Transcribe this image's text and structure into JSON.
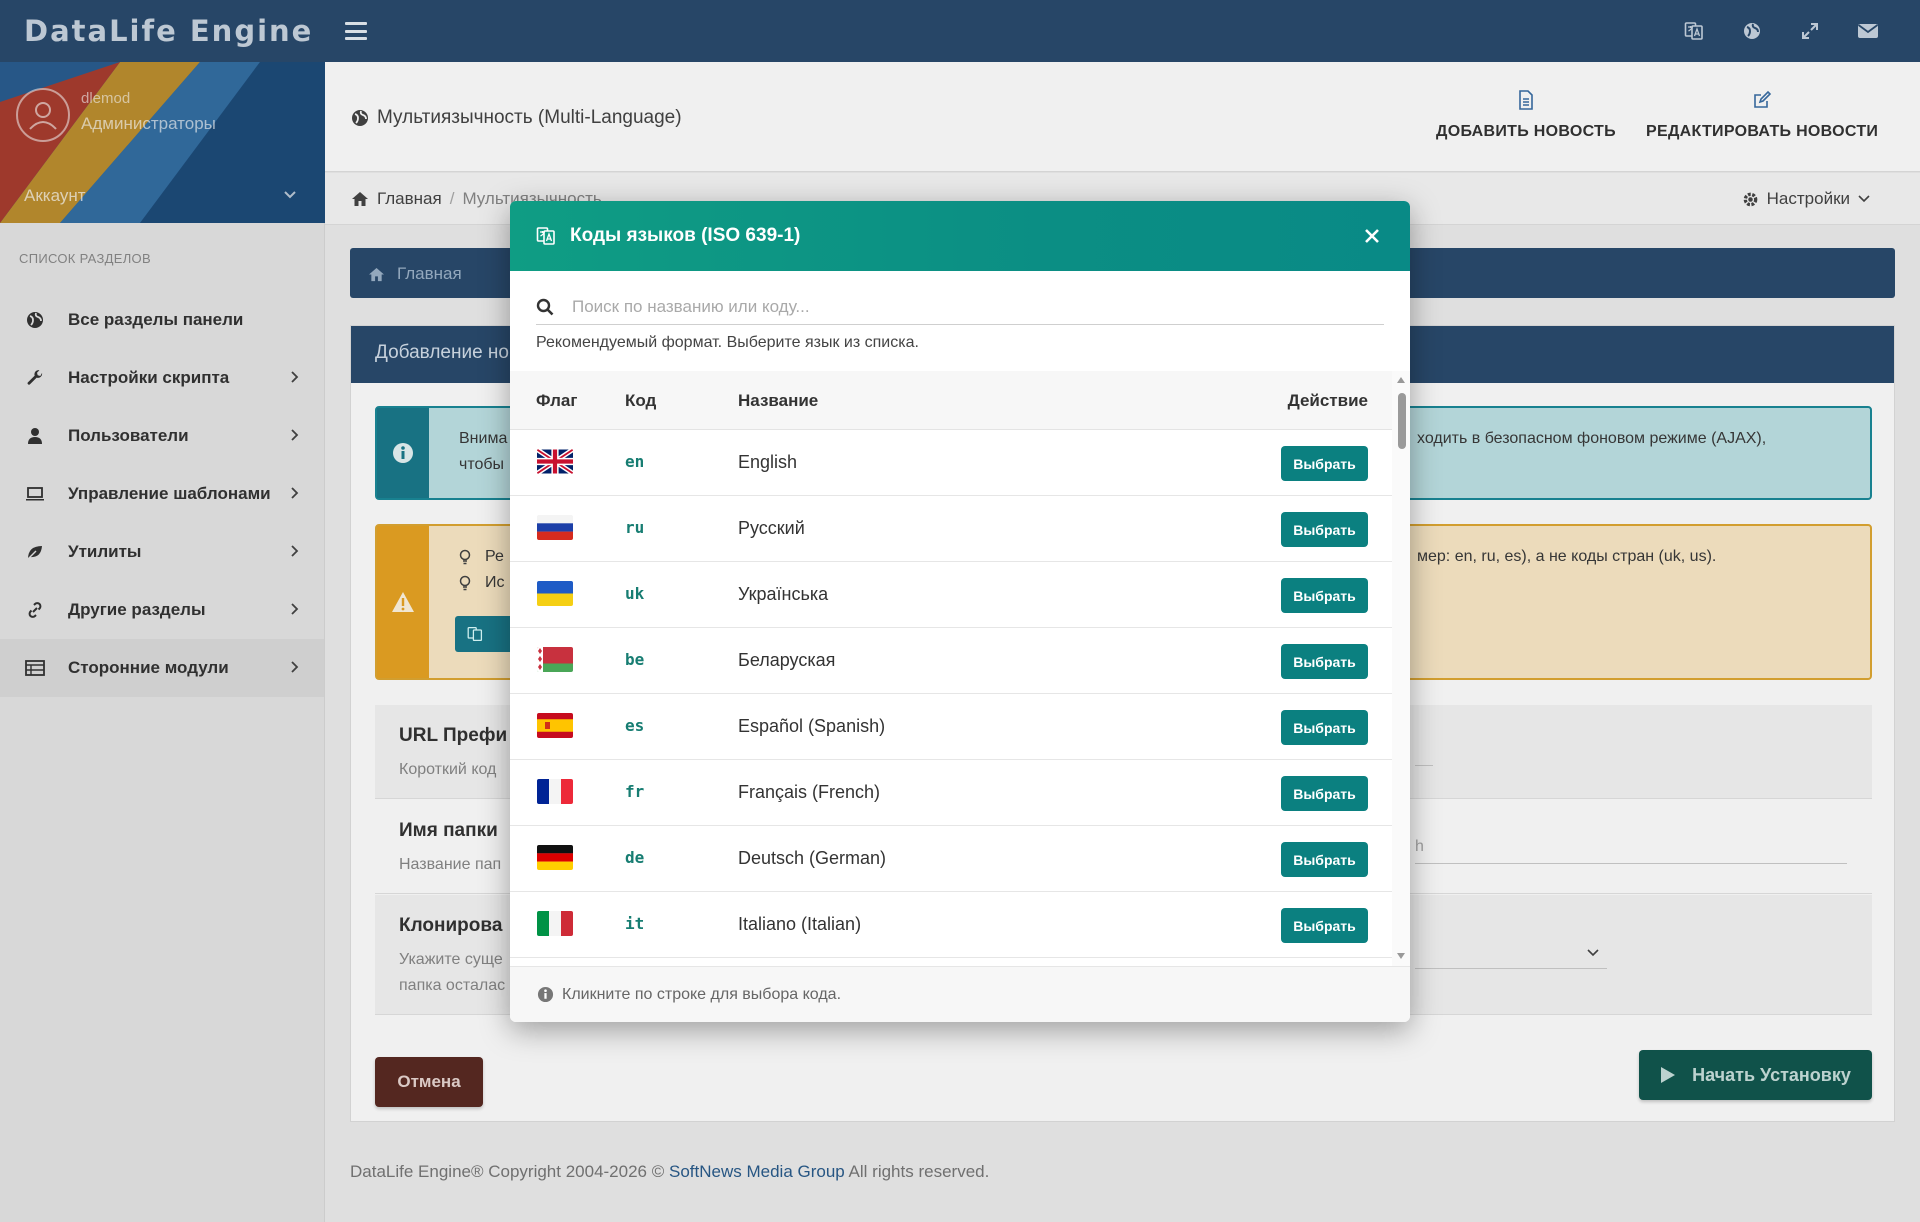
{
  "app": {
    "brand": "DataLife Engine"
  },
  "user": {
    "name": "dlemod",
    "role": "Администраторы",
    "account_label": "Аккаунт"
  },
  "sidebar": {
    "title": "СПИСОК РАЗДЕЛОВ",
    "items": [
      {
        "label": "Все разделы панели",
        "icon": "globe-icon"
      },
      {
        "label": "Настройки скрипта",
        "icon": "wrench-icon"
      },
      {
        "label": "Пользователи",
        "icon": "user-icon"
      },
      {
        "label": "Управление шаблонами",
        "icon": "laptop-icon"
      },
      {
        "label": "Утилиты",
        "icon": "leaf-icon"
      },
      {
        "label": "Другие разделы",
        "icon": "link-icon"
      },
      {
        "label": "Сторонние модули",
        "icon": "list-icon"
      }
    ]
  },
  "header": {
    "title": "Мультиязычность (Multi-Language)",
    "add_news": "ДОБАВИТЬ НОВОСТЬ",
    "edit_news": "РЕДАКТИРОВАТЬ НОВОСТИ"
  },
  "breadcrumb": {
    "home": "Главная",
    "sep": "/",
    "current": "Мультиязычность",
    "settings": "Настройки"
  },
  "panel": {
    "tab_home": "Главная",
    "card_title": "Добавление но",
    "info_line1": "Внима",
    "info_line2": "чтобы",
    "info_right": "ходить в безопасном фоновом режиме (AJAX),",
    "warn_line1": "Ре",
    "warn_line2": "Ис",
    "warn_right": "мер: en, ru, es), а не коды стран (uk, us).",
    "field1_title": "URL Префи",
    "field1_sub": "Короткий код",
    "field2_title": "Имя папки",
    "field2_sub": "Название пап",
    "field2_right": "h",
    "field3_title": "Клонирова",
    "field3_sub1": "Укажите суще",
    "field3_sub2": "папка осталас",
    "cancel": "Отмена",
    "start": "Начать Установку"
  },
  "footer": {
    "prefix": "DataLife Engine® Copyright 2004-2026 ©",
    "link": "SoftNews Media Group",
    "suffix": "All rights reserved."
  },
  "modal": {
    "title": "Коды языков (ISO 639-1)",
    "search_placeholder": "Поиск по названию или коду...",
    "hint": "Рекомендуемый формат. Выберите язык из списка.",
    "columns": {
      "flag": "Флаг",
      "code": "Код",
      "name": "Название",
      "action": "Действие"
    },
    "select_label": "Выбрать",
    "rows": [
      {
        "code": "en",
        "name": "English"
      },
      {
        "code": "ru",
        "name": "Русский"
      },
      {
        "code": "uk",
        "name": "Українська"
      },
      {
        "code": "be",
        "name": "Беларуская"
      },
      {
        "code": "es",
        "name": "Español (Spanish)"
      },
      {
        "code": "fr",
        "name": "Français (French)"
      },
      {
        "code": "de",
        "name": "Deutsch (German)"
      },
      {
        "code": "it",
        "name": "Italiano (Italian)"
      }
    ],
    "footer": "Кликните по строке для выбора кода."
  },
  "colors": {
    "topbar": "#2a4b6e",
    "accent": "#0b8080",
    "modal_header": "#0f9d84"
  }
}
